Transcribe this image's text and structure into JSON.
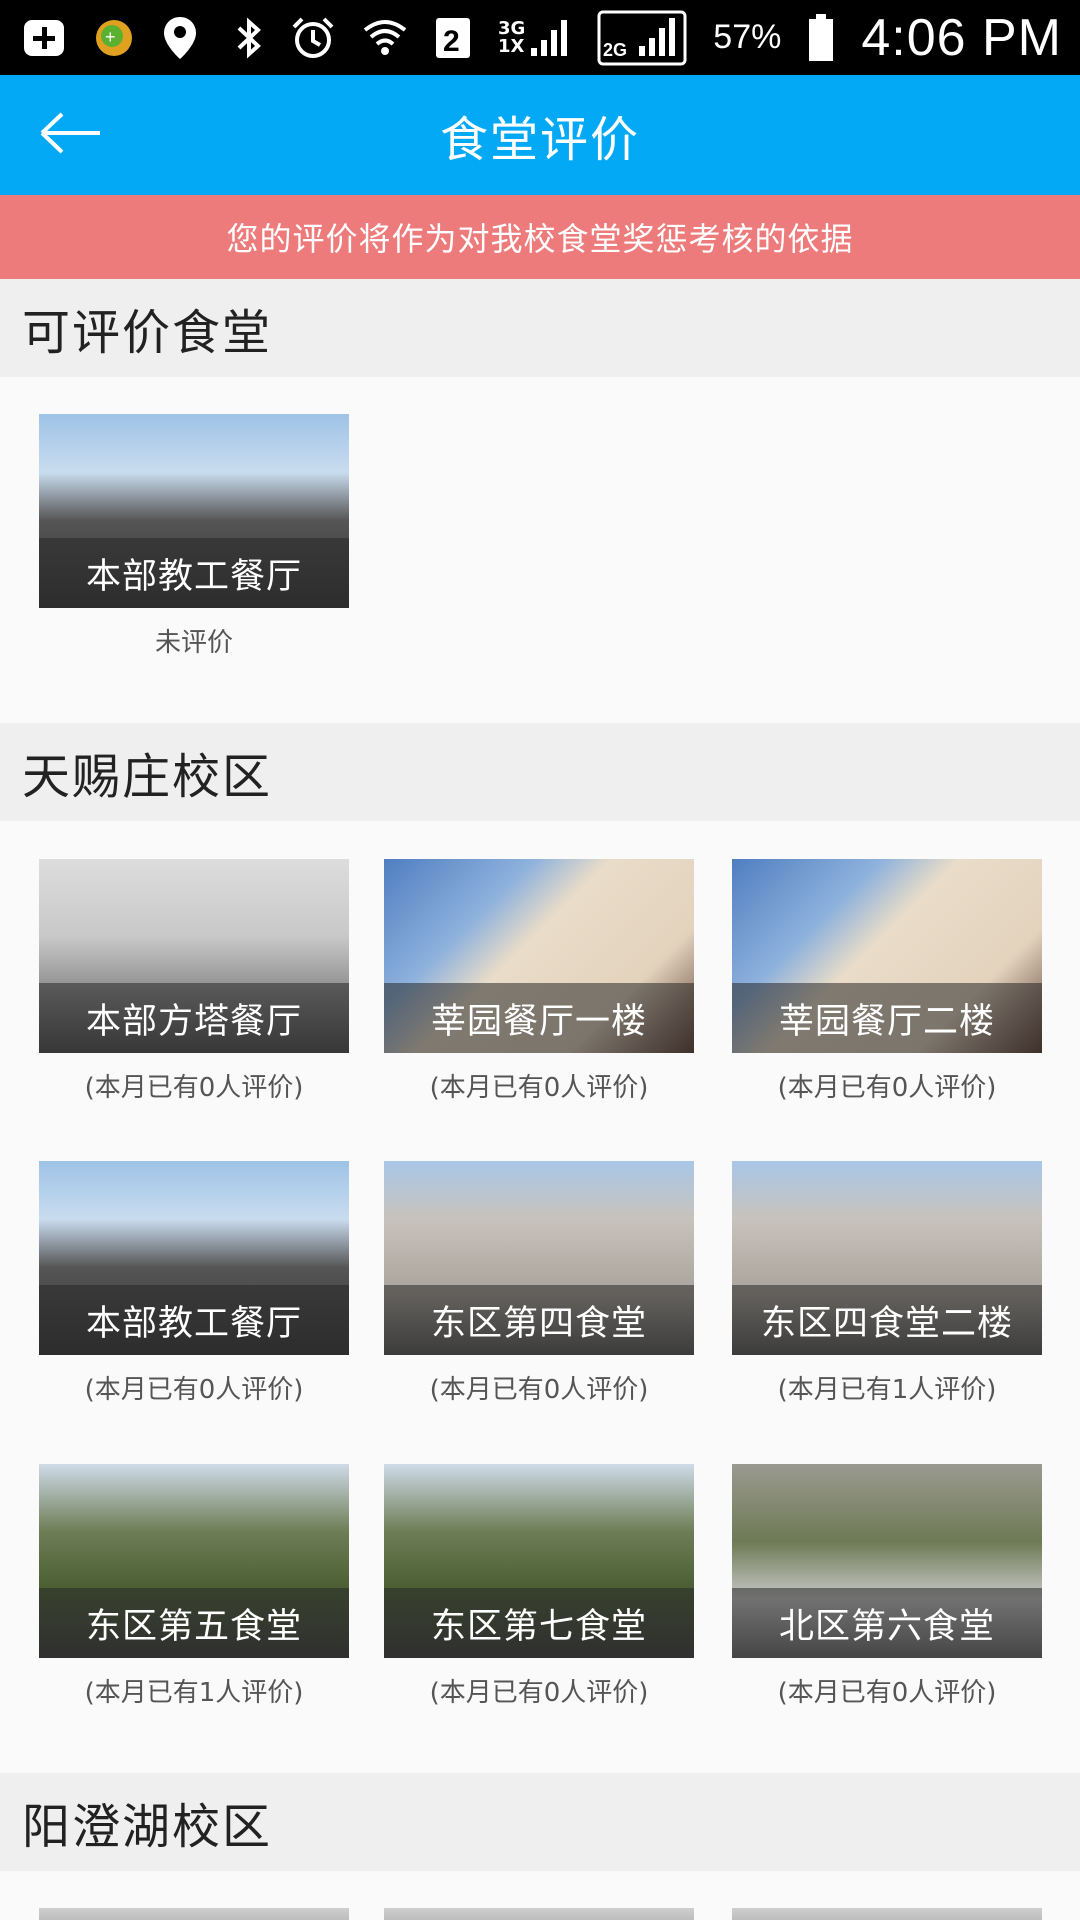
{
  "status_bar": {
    "battery": "57%",
    "time": "4:06 PM",
    "sim_badge": "2",
    "net_3g_top": "3G",
    "net_3g_bottom": "1X",
    "net_2g": "2G",
    "icons": [
      "add-box-icon",
      "app-badge-icon",
      "location-pin-icon",
      "bluetooth-icon",
      "alarm-icon",
      "wifi-icon",
      "sim-2-icon",
      "signal-3g-icon",
      "signal-2g-icon",
      "battery-icon"
    ]
  },
  "app_bar": {
    "title": "食堂评价",
    "back_icon": "arrow-left-icon"
  },
  "notice": "您的评价将作为对我校食堂奖惩考核的依据",
  "colors": {
    "app_bar": "#03a9f4",
    "notice": "#ee7b7b",
    "section_bg": "#efefef",
    "page_bg": "#fafafa"
  },
  "sections": [
    {
      "title": "可评价食堂",
      "cards": [
        {
          "name": "本部教工餐厅",
          "count": "未评价"
        }
      ]
    },
    {
      "title": "天赐庄校区",
      "cards": [
        {
          "name": "本部方塔餐厅",
          "count": "(本月已有0人评价)"
        },
        {
          "name": "莘园餐厅一楼",
          "count": "(本月已有0人评价)"
        },
        {
          "name": "莘园餐厅二楼",
          "count": "(本月已有0人评价)"
        },
        {
          "name": "本部教工餐厅",
          "count": "(本月已有0人评价)"
        },
        {
          "name": "东区第四食堂",
          "count": "(本月已有0人评价)"
        },
        {
          "name": "东区四食堂二楼",
          "count": "(本月已有1人评价)"
        },
        {
          "name": "东区第五食堂",
          "count": "(本月已有1人评价)"
        },
        {
          "name": "东区第七食堂",
          "count": "(本月已有0人评价)"
        },
        {
          "name": "北区第六食堂",
          "count": "(本月已有0人评价)"
        }
      ]
    },
    {
      "title": "阳澄湖校区",
      "cards": []
    }
  ]
}
